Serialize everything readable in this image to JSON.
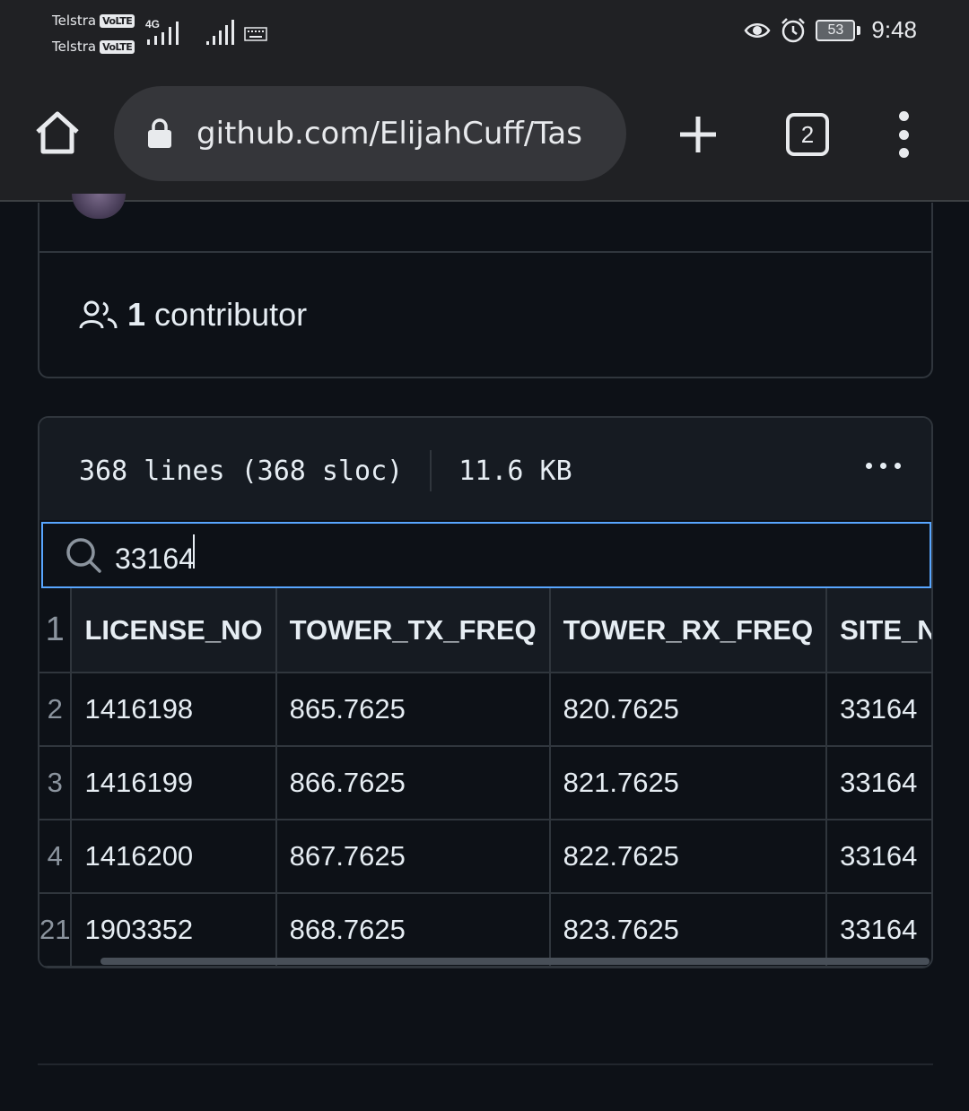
{
  "status_bar": {
    "carrier_1": "Telstra",
    "carrier_2": "Telstra",
    "volte_label": "VoLTE",
    "network_type": "4G",
    "battery_level": "53",
    "time": "9:48",
    "icons": [
      "signal-icon",
      "keyboard-icon",
      "eye-icon",
      "alarm-icon",
      "battery-icon"
    ]
  },
  "browser": {
    "url": "github.com/ElijahCuff/Tas",
    "tab_count": "2",
    "icons": [
      "home-icon",
      "lock-icon",
      "plus-icon",
      "tabs-icon",
      "more-vert-icon"
    ]
  },
  "repo": {
    "contributors_count": "1",
    "contributors_label": "contributor"
  },
  "file": {
    "lines": "368 lines (368 sloc)",
    "size": "11.6 KB",
    "search_value": "33164",
    "table": {
      "header_line": "1",
      "headers": [
        "LICENSE_NO",
        "TOWER_TX_FREQ",
        "TOWER_RX_FREQ",
        "SITE_NO"
      ],
      "rows": [
        {
          "line": "2",
          "cells": [
            "1416198",
            "865.7625",
            "820.7625",
            "33164"
          ]
        },
        {
          "line": "3",
          "cells": [
            "1416199",
            "866.7625",
            "821.7625",
            "33164"
          ]
        },
        {
          "line": "4",
          "cells": [
            "1416200",
            "867.7625",
            "822.7625",
            "33164"
          ]
        },
        {
          "line": "21",
          "cells": [
            "1903352",
            "868.7625",
            "823.7625",
            "33164"
          ]
        }
      ]
    }
  },
  "colors": {
    "page_bg": "#0d1117",
    "browser_bg": "#202124",
    "border": "#30363d",
    "focus": "#58a6ff",
    "muted": "#8b949e"
  }
}
